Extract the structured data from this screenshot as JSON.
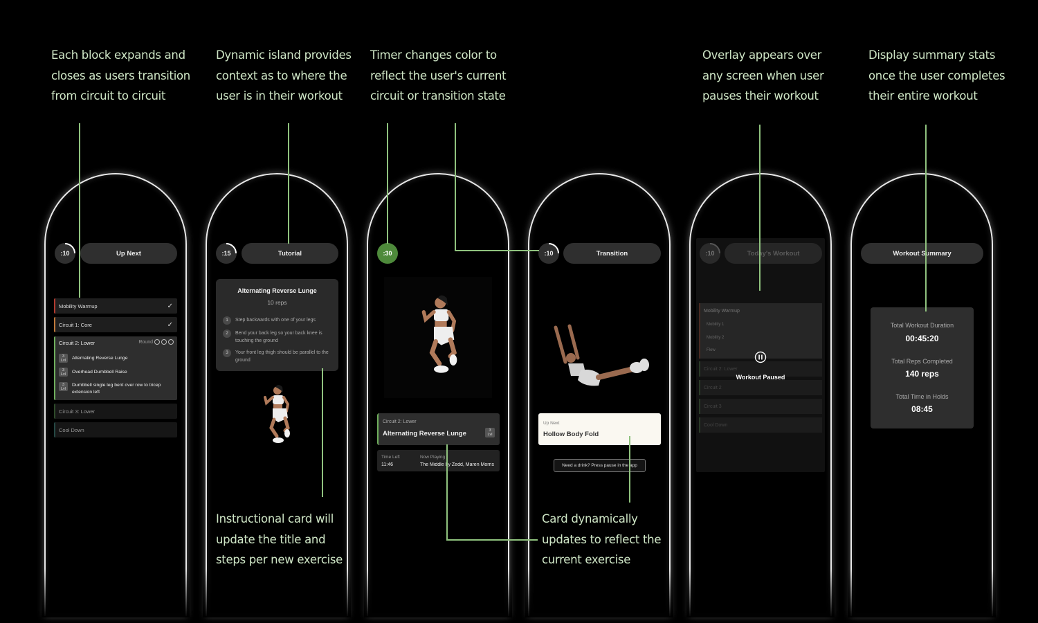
{
  "captions": {
    "blocks": [
      "Each block expands and",
      "closes as users transition",
      "from circuit to circuit"
    ],
    "island": [
      "Dynamic island provides",
      "context as to where the",
      "user is in their workout"
    ],
    "timer": [
      "Timer changes color to",
      "reflect the user's current",
      "circuit or transition state"
    ],
    "overlay": [
      "Overlay appears over",
      "any screen when user",
      "pauses their workout"
    ],
    "summary": [
      "Display summary stats",
      "once the user completes",
      "their entire workout"
    ],
    "instructional": [
      "Instructional card will",
      "update the title and",
      "steps per new exercise"
    ],
    "card": [
      "Card dynamically",
      "updates to reflect the",
      "current exercise"
    ]
  },
  "colors": {
    "accent_green": "#8fc27e",
    "timer_green": "#4e8a3b",
    "warmup_red": "#b33a2e",
    "core_orange": "#c0793a",
    "circuit_green": "#6fae5c"
  },
  "screen1": {
    "timer": ":10",
    "island": "Up Next",
    "blocks": [
      {
        "label": "Mobility Warmup",
        "done": "✓"
      },
      {
        "label": "Circuit 1: Core",
        "done": "✓"
      }
    ],
    "current": {
      "title": "Circuit 2: Lower",
      "round_label": "Round",
      "exercises": [
        {
          "chip_top": "3",
          "chip_bottom": "Lvl",
          "name": "Alternating Reverse Lunge"
        },
        {
          "chip_top": "3",
          "chip_bottom": "Lvl",
          "name": "Overhead Dumbbell Raise"
        },
        {
          "chip_top": "3",
          "chip_bottom": "Lvl",
          "name": "Dumbbell single leg bent over row to tricep extension left"
        }
      ]
    },
    "upcoming": [
      "Circuit 3: Lower",
      "Cool Down"
    ]
  },
  "screen2": {
    "timer": ":15",
    "island": "Tutorial",
    "card": {
      "title": "Alternating Reverse Lunge",
      "reps": "10 reps",
      "steps": [
        {
          "n": "1",
          "text": "Step backwards with one of your legs"
        },
        {
          "n": "2",
          "text": "Bend your back leg so your back knee is touching the ground"
        },
        {
          "n": "3",
          "text": "Your front leg thigh should be parallel to the ground"
        }
      ]
    }
  },
  "screen3": {
    "timer": ":30",
    "card": {
      "circuit": "Circuit 2: Lower",
      "exercise": "Alternating Reverse Lunge",
      "chip_top": "3",
      "chip_bottom": "Lvl"
    },
    "info": {
      "time_left_label": "Time Left",
      "time_left": "11:46",
      "now_playing_label": "Now Playing",
      "now_playing": "The Middle by Zedd, Maren Morris"
    }
  },
  "screen4": {
    "timer": ":10",
    "island": "Transition",
    "up_next_label": "Up Next",
    "up_next": "Hollow Body Fold",
    "hint": "Need a drink? Press pause in the app"
  },
  "screen5": {
    "timer": ":10",
    "island": "Today's Workout",
    "warmup": {
      "title": "Mobility Warmup",
      "items": [
        "Mobility 1",
        "Mobility 2",
        "Flow"
      ]
    },
    "items": [
      "Circuit 2: Lower",
      "Circuit 2",
      "Circuit 3",
      "Cool Down"
    ],
    "paused": "Workout Paused"
  },
  "screen6": {
    "island": "Workout Summary",
    "stats": [
      {
        "label": "Total Workout Duration",
        "value": "00:45:20"
      },
      {
        "label": "Total Reps Completed",
        "value": "140 reps"
      },
      {
        "label": "Total Time in Holds",
        "value": "08:45"
      }
    ]
  }
}
